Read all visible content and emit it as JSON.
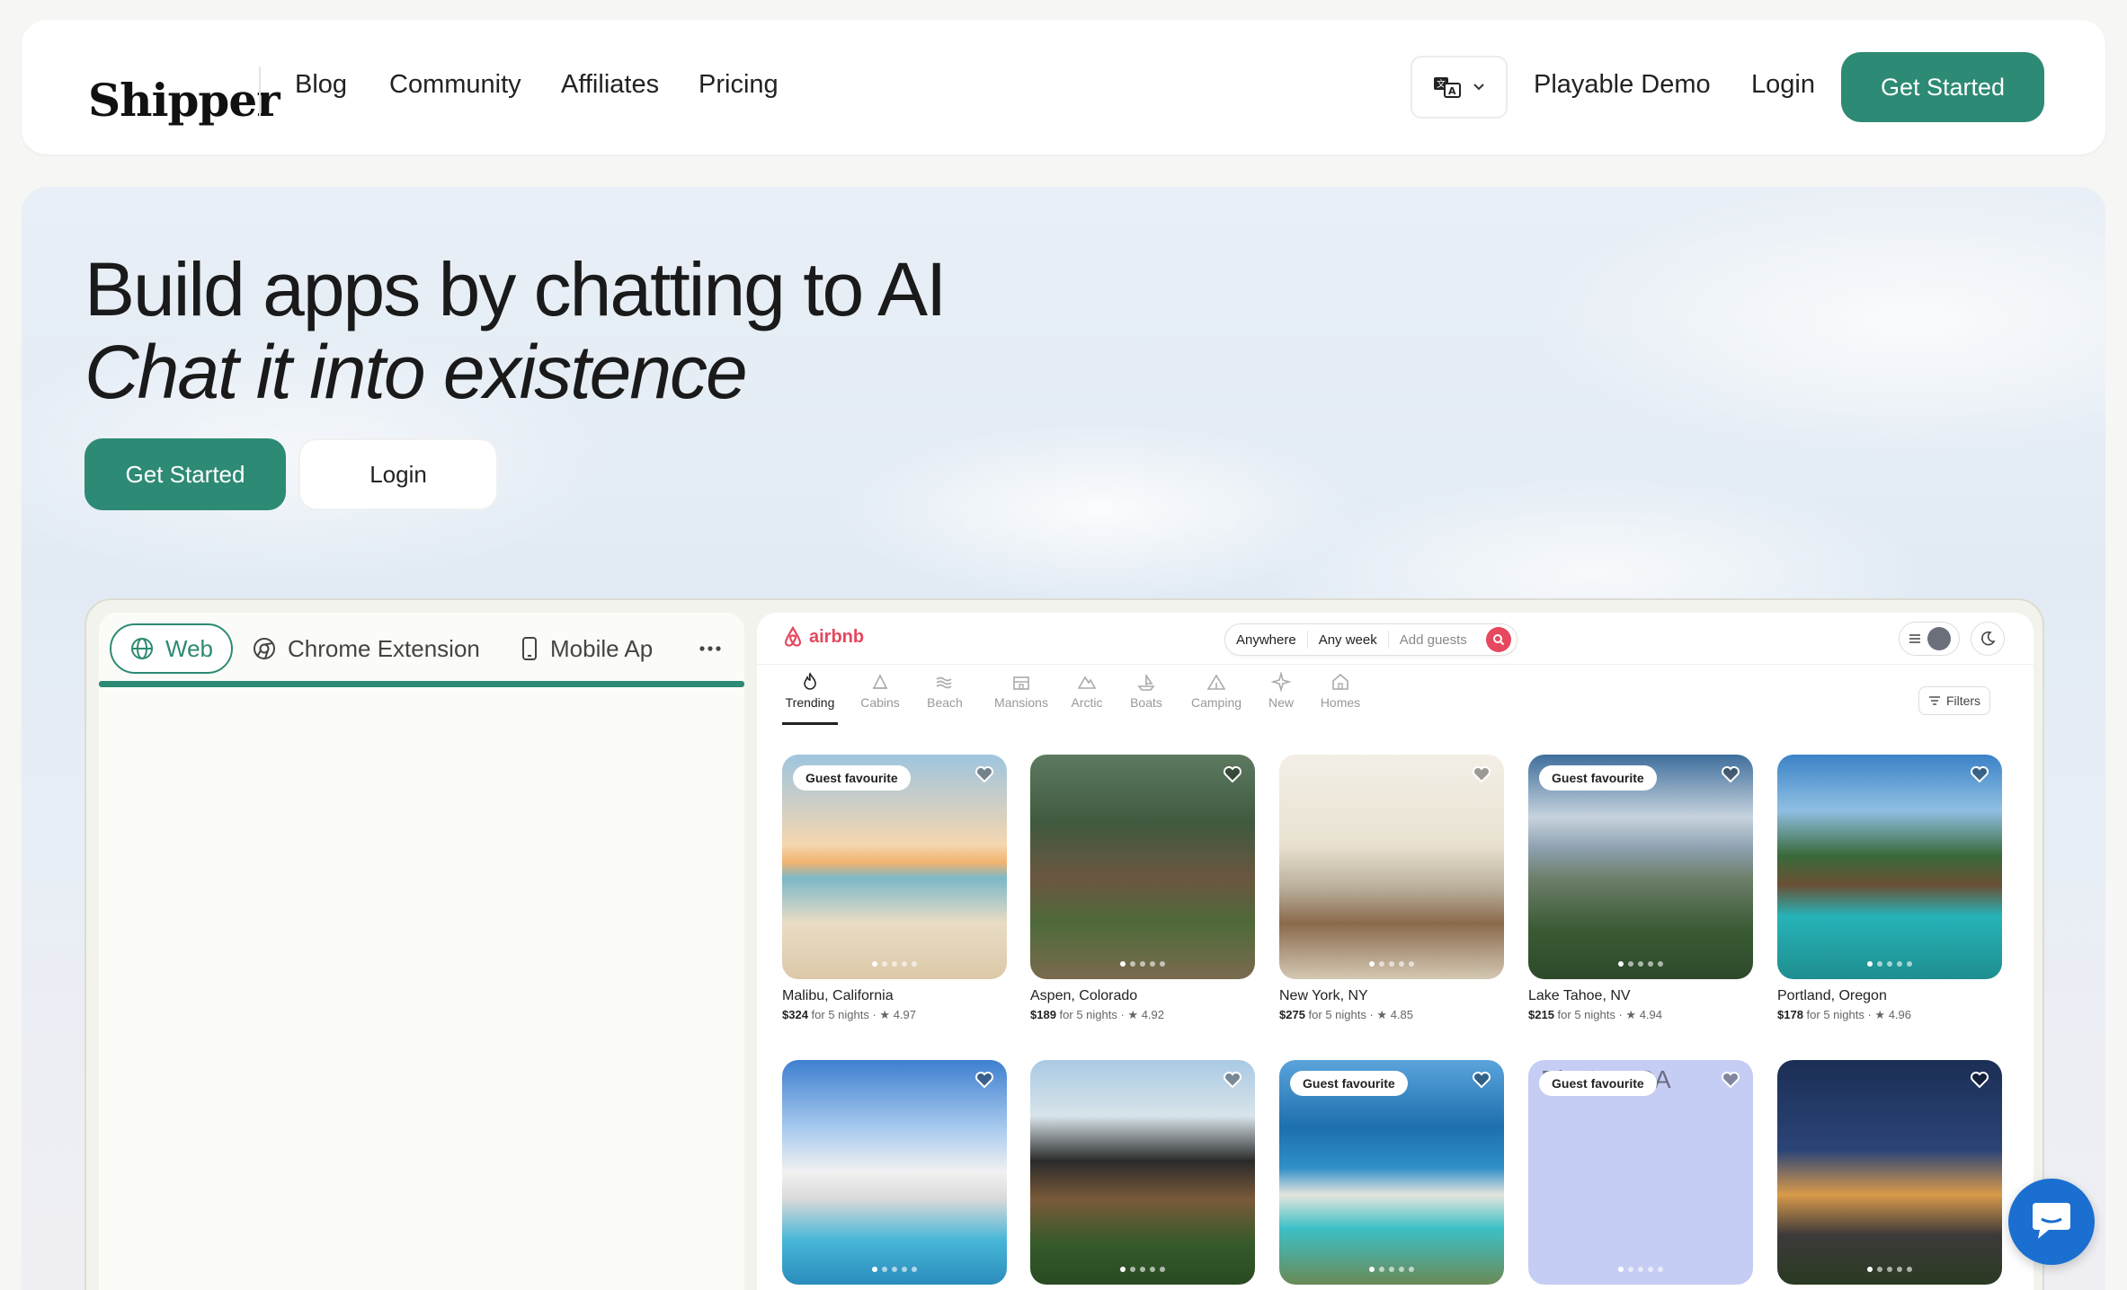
{
  "nav": {
    "logo": "Shipper",
    "links": [
      "Blog",
      "Community",
      "Affiliates",
      "Pricing"
    ],
    "language_icon": "translate-icon",
    "demo": "Playable Demo",
    "login": "Login",
    "cta": "Get Started"
  },
  "hero": {
    "headline": "Build apps by chatting to AI",
    "subheadline": "Chat it into existence",
    "cta": "Get Started",
    "login": "Login"
  },
  "builder": {
    "tabs": [
      "Web",
      "Chrome Extension",
      "Mobile Ap"
    ],
    "active_tab": "Web",
    "more_icon": "more-horizontal-icon"
  },
  "preview": {
    "brand": "airbnb",
    "search": {
      "where": "Anywhere",
      "when": "Any week",
      "guests": "Add guests"
    },
    "categories": [
      "Trending",
      "Cabins",
      "Beach",
      "Mansions",
      "Arctic",
      "Boats",
      "Camping",
      "New",
      "Homes"
    ],
    "active_category": "Trending",
    "filters": "Filters",
    "listings": [
      {
        "location": "Malibu, California",
        "price": "$324",
        "nights": "for 5 nights",
        "rating": "4.97",
        "badge": "Guest favourite"
      },
      {
        "location": "Aspen, Colorado",
        "price": "$189",
        "nights": "for 5 nights",
        "rating": "4.92",
        "badge": ""
      },
      {
        "location": "New York, NY",
        "price": "$275",
        "nights": "for 5 nights",
        "rating": "4.85",
        "badge": ""
      },
      {
        "location": "Lake Tahoe, NV",
        "price": "$215",
        "nights": "for 5 nights",
        "rating": "4.94",
        "badge": "Guest favourite"
      },
      {
        "location": "Portland, Oregon",
        "price": "$178",
        "nights": "for 5 nights",
        "rating": "4.96",
        "badge": ""
      },
      {
        "location": "",
        "price": "",
        "nights": "",
        "rating": "",
        "badge": ""
      },
      {
        "location": "",
        "price": "",
        "nights": "",
        "rating": "",
        "badge": ""
      },
      {
        "location": "",
        "price": "",
        "nights": "",
        "rating": "",
        "badge": "Guest favourite"
      },
      {
        "location": "",
        "price": "",
        "nights": "",
        "rating": "",
        "badge": "Guest favourite",
        "broken_alt": "Big Sur, CA"
      },
      {
        "location": "",
        "price": "",
        "nights": "",
        "rating": "",
        "badge": ""
      }
    ]
  },
  "colors": {
    "brand_green": "#2d8a74",
    "airbnb": "#e5485f",
    "chat": "#1a6fd1"
  }
}
